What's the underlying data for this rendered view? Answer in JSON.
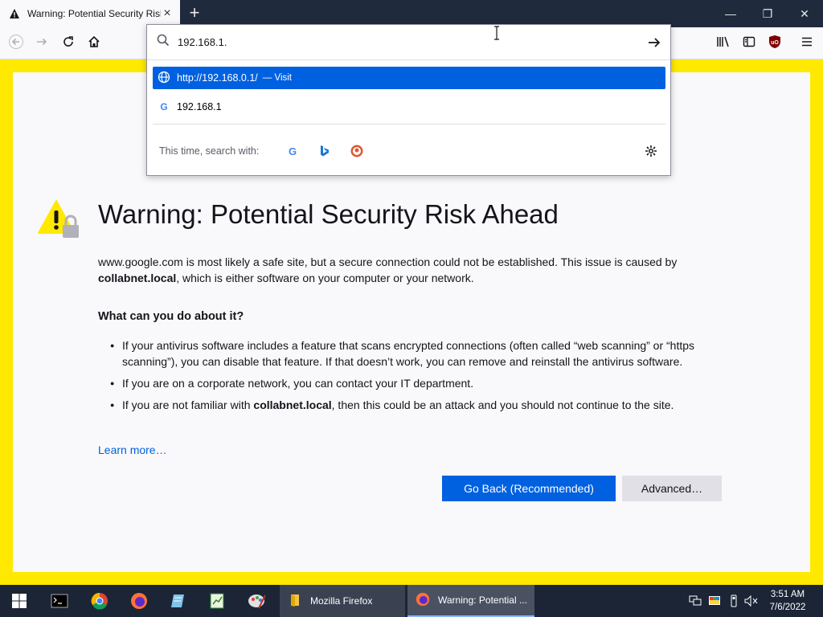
{
  "browser": {
    "tab": {
      "title": "Warning: Potential Security Risk Ahead",
      "close_label": "×"
    },
    "new_tab_label": "+",
    "window_controls": {
      "minimize": "—",
      "maximize": "❐",
      "close": "✕"
    }
  },
  "url_bar": {
    "value": "192.168.1.",
    "suggestions": [
      {
        "text": "http://192.168.0.1/",
        "action": "— Visit",
        "icon": "globe-icon"
      },
      {
        "text": "192.168.1",
        "action": "",
        "icon": "google-icon"
      }
    ],
    "search_with_label": "This time, search with:",
    "engines": [
      "Google",
      "Bing",
      "DuckDuckGo"
    ]
  },
  "page": {
    "title": "Warning: Potential Security Risk Ahead",
    "description_part1": "www.google.com is most likely a safe site, but a secure connection could not be established. This issue is caused by ",
    "description_bold": "collabnet.local",
    "description_part2": ", which is either software on your computer or your network.",
    "what_heading": "What can you do about it?",
    "tip1": "If your antivirus software includes a feature that scans encrypted connections (often called “web scanning” or “https scanning”), you can disable that feature. If that doesn’t work, you can remove and reinstall the antivirus software.",
    "tip2": "If you are on a corporate network, you can contact your IT department.",
    "tip3_part1": "If you are not familiar with ",
    "tip3_bold": "collabnet.local",
    "tip3_part2": ", then this could be an attack and you should not continue to the site.",
    "learn_more": "Learn more…",
    "go_back_button": "Go Back (Recommended)",
    "advanced_button": "Advanced…"
  },
  "taskbar": {
    "apps": [
      {
        "label": "Mozilla Firefox",
        "icon": "folder-icon"
      },
      {
        "label": "Warning: Potential ...",
        "icon": "firefox-icon"
      }
    ],
    "clock": {
      "time": "3:51 AM",
      "date": "7/6/2022"
    }
  },
  "colors": {
    "accent": "#0061e0",
    "warning_border": "#ffe900",
    "taskbar": "#1b2536"
  }
}
